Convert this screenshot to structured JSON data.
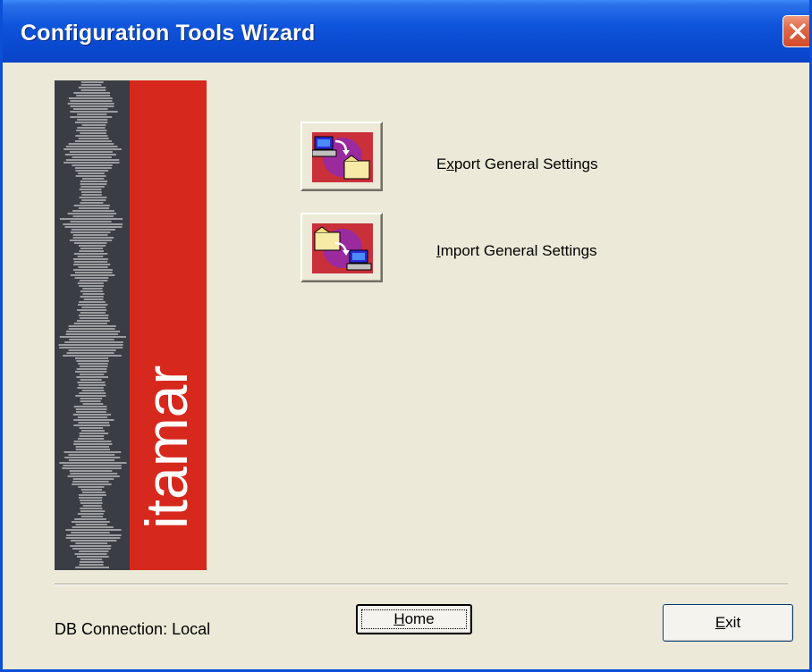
{
  "window": {
    "title": "Configuration Tools Wizard",
    "close_icon": "close-icon"
  },
  "banner": {
    "brand_text": "itamar",
    "colors": {
      "dark": "#3a3d44",
      "red": "#d6281c"
    }
  },
  "actions": [
    {
      "id": "export",
      "icon": "export-settings-icon",
      "label_prefix": "E",
      "label_underline": "x",
      "label_rest": "port General Settings"
    },
    {
      "id": "import",
      "icon": "import-settings-icon",
      "label_prefix": "",
      "label_underline": "I",
      "label_rest": "mport General Settings"
    }
  ],
  "footer": {
    "status": "DB Connection: Local",
    "home": {
      "underline": "H",
      "rest": "ome"
    },
    "exit": {
      "underline": "E",
      "rest": "xit"
    }
  }
}
